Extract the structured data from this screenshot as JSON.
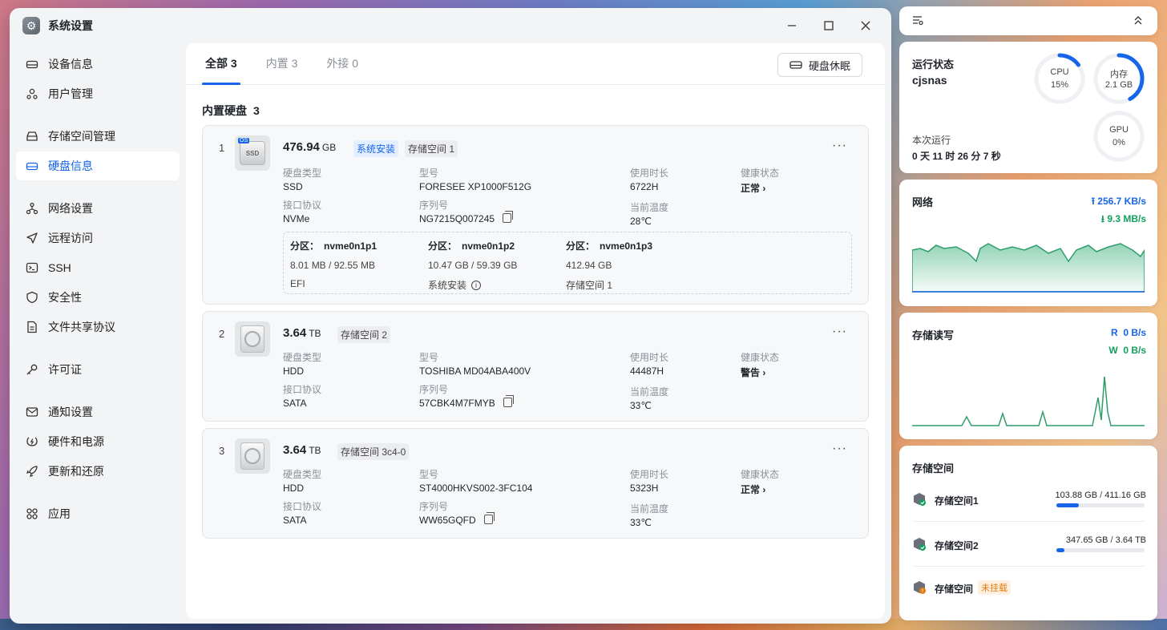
{
  "window": {
    "title": "系统设置"
  },
  "sidebar": {
    "items": [
      {
        "label": "设备信息",
        "icon": "drive-icon"
      },
      {
        "label": "用户管理",
        "icon": "users-icon"
      },
      {
        "label": "存储空间管理",
        "icon": "storage-icon"
      },
      {
        "label": "硬盘信息",
        "icon": "drive-icon"
      },
      {
        "label": "网络设置",
        "icon": "network-icon"
      },
      {
        "label": "远程访问",
        "icon": "send-icon"
      },
      {
        "label": "SSH",
        "icon": "terminal-icon"
      },
      {
        "label": "安全性",
        "icon": "shield-icon"
      },
      {
        "label": "文件共享协议",
        "icon": "file-icon"
      },
      {
        "label": "许可证",
        "icon": "key-icon"
      },
      {
        "label": "通知设置",
        "icon": "mail-icon"
      },
      {
        "label": "硬件和电源",
        "icon": "power-icon"
      },
      {
        "label": "更新和还原",
        "icon": "rocket-icon"
      },
      {
        "label": "应用",
        "icon": "apps-icon"
      }
    ],
    "active": "硬盘信息"
  },
  "tabs": [
    {
      "label": "全部 3"
    },
    {
      "label": "内置 3"
    },
    {
      "label": "外接 0"
    }
  ],
  "sleep_button": "硬盘休眠",
  "section": {
    "title": "内置硬盘",
    "count": "3"
  },
  "labels": {
    "type": "硬盘类型",
    "model": "型号",
    "hours": "使用时长",
    "health": "健康状态",
    "iface": "接口协议",
    "serial": "序列号",
    "temp": "当前温度",
    "partition": "分区："
  },
  "disks": [
    {
      "index": "1",
      "capacity": "476.94",
      "unit": "GB",
      "icon_text": "SSD",
      "os_badge": "OS",
      "tags": [
        "系统安装",
        "存储空间 1"
      ],
      "type": "SSD",
      "model": "FORESEE XP1000F512G",
      "hours": "6722H",
      "health": "正常",
      "iface": "NVMe",
      "serial": "NG7215Q007245",
      "temp": "28℃",
      "partitions": [
        {
          "name": "nvme0n1p1",
          "size": "8.01 MB / 92.55 MB",
          "use": "EFI"
        },
        {
          "name": "nvme0n1p2",
          "size": "10.47 GB / 59.39 GB",
          "use": "系统安装"
        },
        {
          "name": "nvme0n1p3",
          "size": "412.94 GB",
          "use": "存储空间 1"
        }
      ]
    },
    {
      "index": "2",
      "capacity": "3.64",
      "unit": "TB",
      "tags": [
        "存储空间 2"
      ],
      "type": "HDD",
      "model": "TOSHIBA MD04ABA400V",
      "hours": "44487H",
      "health": "警告",
      "iface": "SATA",
      "serial": "57CBK4M7FMYB",
      "temp": "33℃"
    },
    {
      "index": "3",
      "capacity": "3.64",
      "unit": "TB",
      "tags": [
        "存储空间 3c4-0"
      ],
      "type": "HDD",
      "model": "ST4000HKVS002-3FC104",
      "hours": "5323H",
      "health": "正常",
      "iface": "SATA",
      "serial": "WW65GQFD",
      "temp": "33℃"
    }
  ],
  "status_widget": {
    "title": "运行状态",
    "host": "cjsnas",
    "uptime_label": "本次运行",
    "uptime": "0 天 11 时 26 分 7 秒",
    "cpu": {
      "label": "CPU",
      "value": "15%",
      "fraction": 0.15
    },
    "mem": {
      "label": "内存",
      "value": "2.1 GB",
      "fraction": 0.42
    },
    "gpu": {
      "label": "GPU",
      "value": "0%",
      "fraction": 0
    }
  },
  "network_widget": {
    "title": "网络",
    "up": "256.7 KB/s",
    "down": "9.3 MB/s"
  },
  "io_widget": {
    "title": "存储读写",
    "read_label": "R",
    "read": "0 B/s",
    "write_label": "W",
    "write": "0 B/s"
  },
  "storage_widget": {
    "title": "存储空间",
    "pools": [
      {
        "name": "存储空间1",
        "used": "103.88 GB",
        "total": "411.16 GB",
        "fraction": 0.25
      },
      {
        "name": "存储空间2",
        "used": "347.65 GB",
        "total": "3.64 TB",
        "fraction": 0.09
      },
      {
        "name": "存储空间",
        "badge": "未挂载"
      }
    ]
  },
  "colors": {
    "accent": "#1765e8",
    "ok": "#12a05c",
    "warn": "#e27b0d"
  }
}
